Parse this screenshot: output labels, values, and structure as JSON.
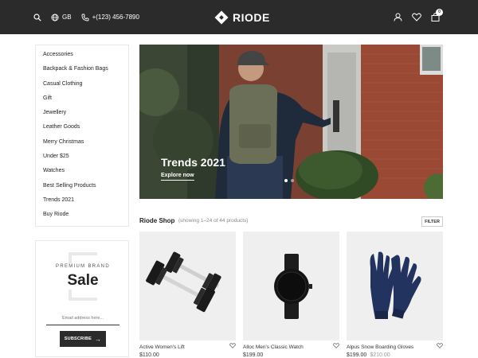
{
  "header": {
    "language": "GB",
    "phone": "+(123) 456-7890",
    "logo": "RIODE",
    "cart_count": "0"
  },
  "sidebar": {
    "categories": [
      "Accessories",
      "Backpack & Fashion Bags",
      "Casual Clothing",
      "Gift",
      "Jewellery",
      "Leather Goods",
      "Merry Christmas",
      "Under $25",
      "Watches",
      "Best Selling Products",
      "Trends 2021",
      "Buy Riode"
    ],
    "promo": {
      "subtitle": "PREMIUM BRAND",
      "title": "Sale",
      "email_placeholder": "Email address here...",
      "button": "SUBSCRIBE"
    }
  },
  "hero": {
    "title": "Trends 2021",
    "link": "Explore now",
    "slides_total": 2,
    "active_slide": 1
  },
  "shop": {
    "title": "Riode Shop",
    "count_text": "(showing 1–24 of 44 products)",
    "filter_label": "FILTER"
  },
  "products": [
    {
      "name": "Active Women's Lift",
      "price": "$110.00",
      "old_price": "",
      "icon": "dumbbells-image"
    },
    {
      "name": "Alloc Men's Classic Watch",
      "price": "$199.00",
      "old_price": "",
      "icon": "watch-image"
    },
    {
      "name": "Alpus Snow Boarding Gloves",
      "price": "$199.00",
      "old_price": "$210.00",
      "icon": "gloves-image"
    }
  ],
  "colors": {
    "header_bg": "#2b2b2b",
    "accent": "#2b2b2b",
    "product_bg": "#efefef"
  }
}
